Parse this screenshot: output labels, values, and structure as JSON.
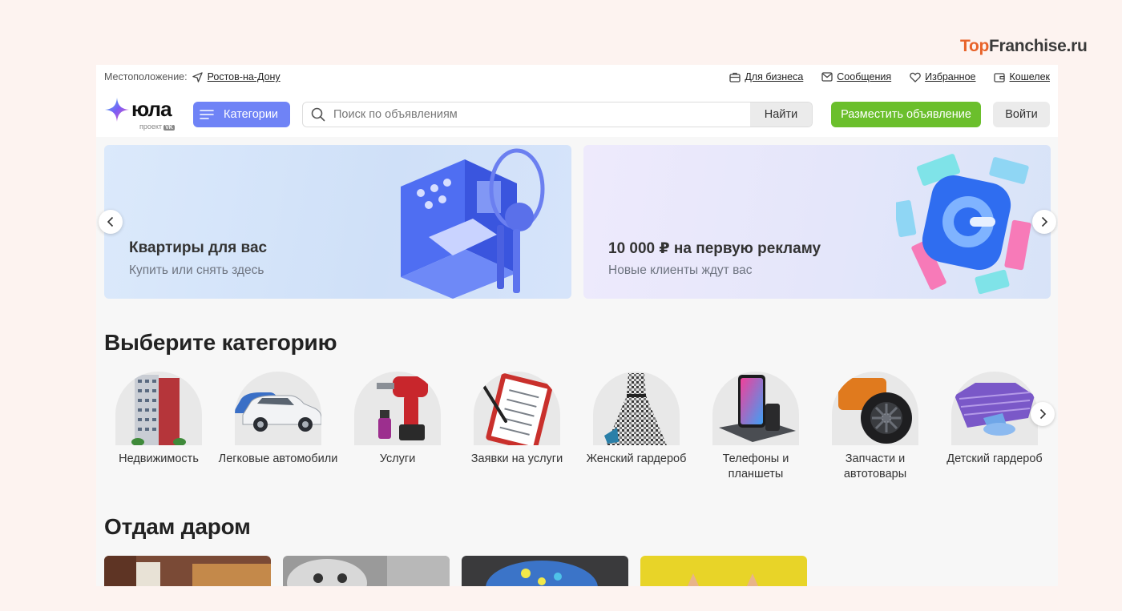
{
  "watermark": {
    "part1": "Top",
    "part2": "Franchise.ru"
  },
  "topbar": {
    "location_label": "Местоположение:",
    "city": "Ростов-на-Дону",
    "links": [
      {
        "label": "Для бизнеса",
        "icon": "briefcase-icon"
      },
      {
        "label": "Сообщения",
        "icon": "mail-icon"
      },
      {
        "label": "Избранное",
        "icon": "heart-icon"
      },
      {
        "label": "Кошелек",
        "icon": "wallet-icon"
      }
    ]
  },
  "header": {
    "logo_text": "юла",
    "logo_sub": "проект",
    "logo_badge": "VK",
    "categories_label": "Категории",
    "search_placeholder": "Поиск по объявлениям",
    "search_button": "Найти",
    "post_button": "Разместить объявление",
    "login_button": "Войти"
  },
  "banners": [
    {
      "title": "Квартиры для вас",
      "subtitle": "Купить или снять здесь"
    },
    {
      "title": "10 000 ₽ на первую рекламу",
      "subtitle": "Новые клиенты ждут вас"
    }
  ],
  "categories_section": {
    "heading": "Выберите категорию",
    "items": [
      {
        "label": "Недвижимость",
        "icon": "building-icon"
      },
      {
        "label": "Легковые автомобили",
        "icon": "car-icon"
      },
      {
        "label": "Услуги",
        "icon": "drill-icon"
      },
      {
        "label": "Заявки на услуги",
        "icon": "clipboard-icon"
      },
      {
        "label": "Женский гардероб",
        "icon": "dress-icon"
      },
      {
        "label": "Телефоны и планшеты",
        "icon": "phone-icon"
      },
      {
        "label": "Запчасти и автотовары",
        "icon": "wheel-icon"
      },
      {
        "label": "Детский гардероб",
        "icon": "kids-clothes-icon"
      }
    ]
  },
  "free_section": {
    "heading": "Отдам даром"
  },
  "colors": {
    "accent": "#6f83f6",
    "post_button": "#6bbf2c",
    "watermark_orange": "#e8632a"
  }
}
